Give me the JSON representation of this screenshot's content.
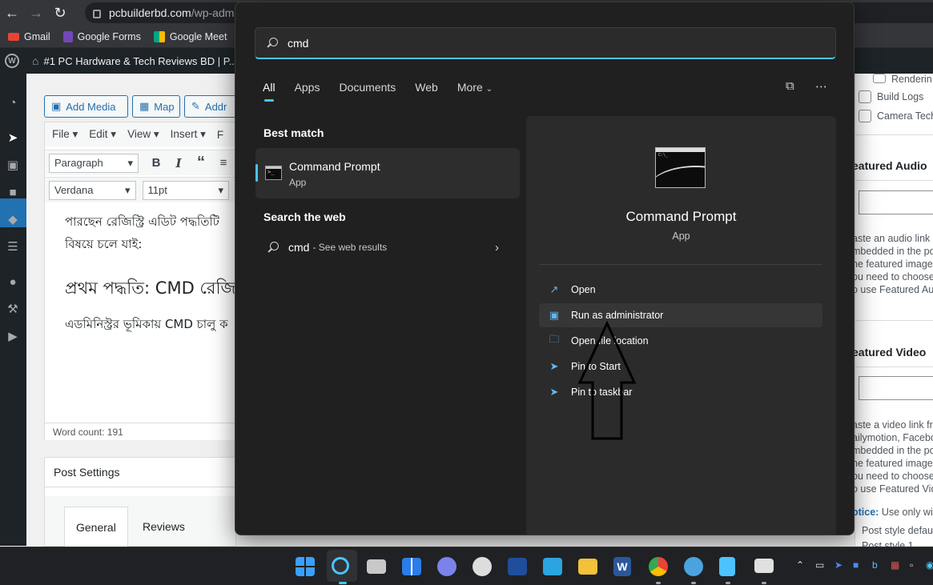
{
  "browser": {
    "url_host": "pcbuilderbd.com",
    "url_path": "/wp-adm",
    "bookmarks": [
      {
        "label": "Gmail",
        "color": "#ea4335"
      },
      {
        "label": "Google Forms",
        "color": "#7248b9"
      },
      {
        "label": "Google Meet",
        "color": "#00a67e"
      }
    ]
  },
  "wp": {
    "site_title": "#1 PC Hardware & Tech Reviews BD | P...",
    "buttons": {
      "add_media": "Add Media",
      "map": "Map",
      "add_other": "Addr"
    },
    "menubar": [
      "File ▾",
      "Edit ▾",
      "View ▾",
      "Insert ▾",
      "F"
    ],
    "format_select": "Paragraph",
    "font_select": "Verdana",
    "size_select": "11pt",
    "content": {
      "line1": "পারছেন রেজিস্ট্রি এডিট পদ্ধতিটি",
      "line2": "বিষয়ে চলে যাই:",
      "heading": "প্রথম পদ্ধতি: CMD রেজি",
      "line3": "এডমিনিস্ট্রর ভূমিকায় CMD চালু ক"
    },
    "word_count": "Word count: 191",
    "post_settings": {
      "title": "Post Settings",
      "tabs": [
        "General",
        "Reviews"
      ]
    },
    "right_panel": {
      "checks": [
        "Renderin",
        "Build Logs",
        "Camera Tech"
      ],
      "featured_audio": "eatured Audio",
      "audio_help": [
        "aste an audio link f",
        "mbedded in the po",
        "ne featured image c",
        "ou need to choose",
        "o use Featured Aud"
      ],
      "featured_video": "eatured Video",
      "video_help": [
        "aste a video link fro",
        "ailymotion, Facebo",
        "mbedded in the po",
        "ne featured image c",
        "ou need to choose",
        "o use Featured Vide"
      ],
      "notice_label": "otice:",
      "notice_text": "Use only wit",
      "post_style_default": "Post style default",
      "post_style_1": "Post style 1"
    }
  },
  "search": {
    "query": "cmd",
    "tabs": [
      "All",
      "Apps",
      "Documents",
      "Web",
      "More"
    ],
    "best_match_label": "Best match",
    "best_match": {
      "name": "Command Prompt",
      "type": "App"
    },
    "search_web_label": "Search the web",
    "web_query": "cmd",
    "web_hint": "- See web results",
    "detail": {
      "name": "Command Prompt",
      "type": "App",
      "actions": [
        "Open",
        "Run as administrator",
        "Open file location",
        "Pin to Start",
        "Pin to taskbar"
      ]
    }
  },
  "colors": {
    "accent": "#4cc2ff",
    "wp_blue": "#2271b1"
  }
}
